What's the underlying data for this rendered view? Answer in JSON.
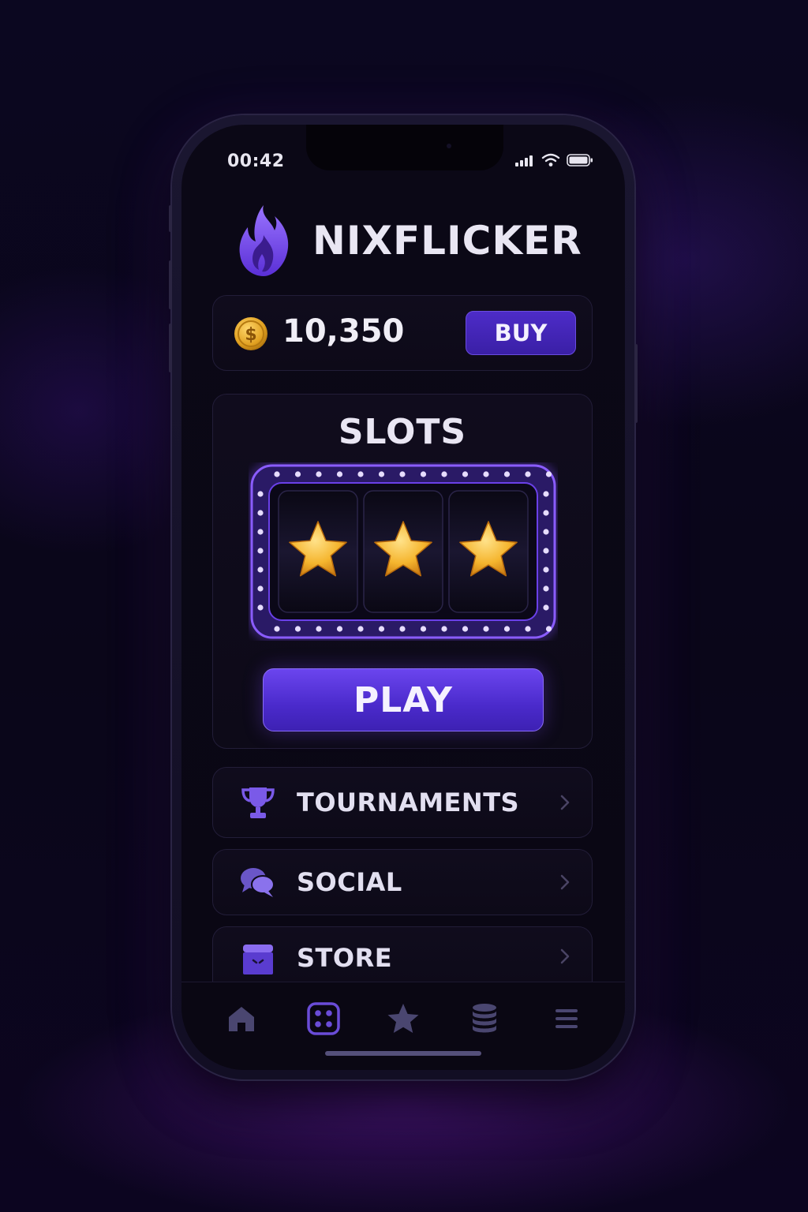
{
  "status_bar": {
    "time": "00:42"
  },
  "brand": {
    "name": "NIXFLICKER",
    "logo_icon": "flame-icon"
  },
  "balance": {
    "coins": "10,350",
    "coin_icon": "dollar-coin-icon",
    "buy_label": "BUY"
  },
  "slots": {
    "title": "SLOTS",
    "reels": [
      "star",
      "star",
      "star"
    ],
    "play_label": "PLAY"
  },
  "menu": [
    {
      "label": "TOURNAMENTS",
      "icon": "trophy-icon"
    },
    {
      "label": "SOCIAL",
      "icon": "chat-bubbles-icon"
    },
    {
      "label": "STORE",
      "icon": "store-icon"
    }
  ],
  "tabbar": [
    {
      "icon": "home-icon",
      "active": false
    },
    {
      "icon": "dice-icon",
      "active": true
    },
    {
      "icon": "star-icon",
      "active": false
    },
    {
      "icon": "coin-stack-icon",
      "active": false
    },
    {
      "icon": "menu-icon",
      "active": false
    }
  ],
  "colors": {
    "accent": "#5b36e0",
    "accent_light": "#8a6cf6",
    "coin_gold": "#e0a020",
    "star_gold": "#f5b52e",
    "background": "#0a0714"
  }
}
